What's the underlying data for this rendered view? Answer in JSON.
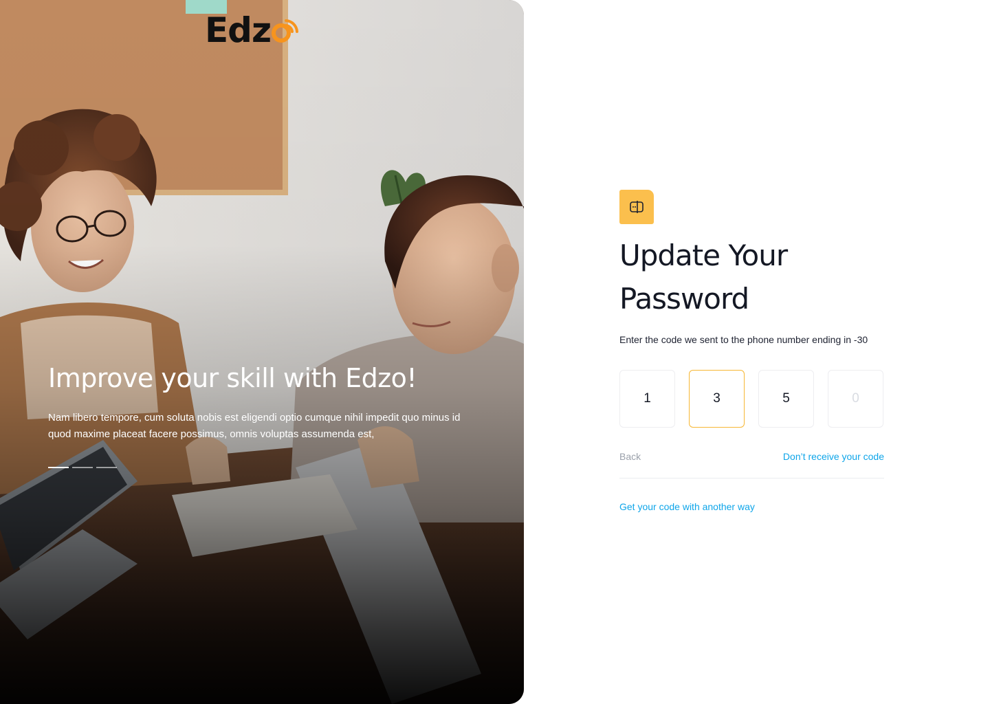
{
  "brand": {
    "name_prefix": "Edz",
    "accent_color": "#f7941d",
    "badge_color": "#fbbf4d",
    "link_color": "#0ea5e9"
  },
  "hero": {
    "title": "Improve your skill with Edzo!",
    "description": "Nam libero tempore, cum soluta nobis est eligendi optio cumque nihil impedit quo minus id quod maxime placeat facere possimus, omnis voluptas assumenda est,",
    "slides": {
      "count": 3,
      "active_index": 0
    },
    "image": "two women smiling at a table with a laptop"
  },
  "form": {
    "icon": "lock-icon",
    "title": "Update Your Password",
    "instruction": "Enter the code we sent to the phone number ending in -30",
    "code": {
      "digits": [
        "1",
        "3",
        "5",
        ""
      ],
      "placeholder_last": "0",
      "focused_index": 1
    },
    "back_label": "Back",
    "resend_label": "Don’t receive your code",
    "alt_method_label": "Get your code with another way"
  }
}
